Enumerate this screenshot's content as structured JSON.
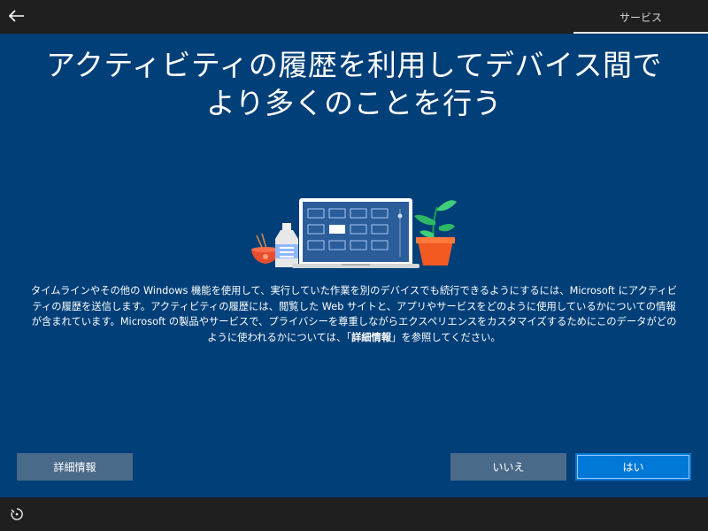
{
  "header": {
    "step_label": "サービス"
  },
  "page": {
    "title_line1": "アクティビティの履歴を利用してデバイス間で",
    "title_line2": "より多くのことを行う",
    "description_main": "タイムラインやその他の Windows 機能を使用して、実行していた作業を別のデバイスでも続行できるようにするには、Microsoft にアクティビティの履歴を送信します。アクティビティの履歴には、閲覧した Web サイトと、アプリやサービスをどのように使用しているかについての情報が含まれています。Microsoft の製品やサービスで、プライバシーを尊重しながらエクスペリエンスをカスタマイズするためにこのデータがどのように使われるかについては、「",
    "description_link": "詳細情報",
    "description_end": "」を参照してください。"
  },
  "buttons": {
    "details": "詳細情報",
    "no": "いいえ",
    "yes": "はい"
  },
  "icons": {
    "back": "arrow-left-icon",
    "accessibility": "accessibility-icon"
  },
  "colors": {
    "background": "#003f78",
    "bar": "#1f1f1f",
    "primary_button": "#0078d7",
    "secondary_button": "#4a6a8a"
  }
}
